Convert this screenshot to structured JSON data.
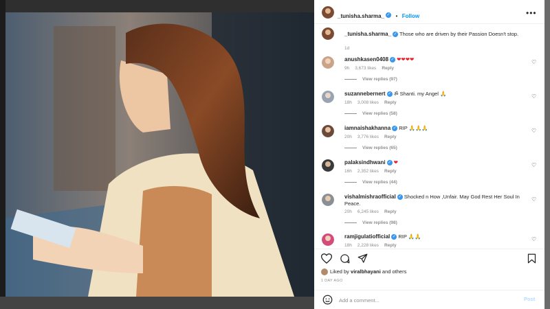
{
  "header": {
    "username": "_tunisha.sharma_",
    "follow_label": "Follow",
    "separator": "•",
    "more_icon": "more-horizontal-icon"
  },
  "caption": {
    "username": "_tunisha.sharma_",
    "text": "Those who are driven by their Passion Doesn't stop.",
    "age": "1d"
  },
  "comments": [
    {
      "username": "anushkasen0408",
      "text": "❤❤❤❤",
      "age": "9h",
      "likes": "3,673 likes",
      "reply": "Reply",
      "view_replies": "View replies (97)"
    },
    {
      "username": "suzannebernert",
      "text": "ॐ Shanti. my Angel 🙏",
      "age": "18h",
      "likes": "3,008 likes",
      "reply": "Reply",
      "view_replies": "View replies (58)"
    },
    {
      "username": "iamnaishakhanna",
      "text": "RIP 🙏🙏🙏",
      "age": "20h",
      "likes": "3,776 likes",
      "reply": "Reply",
      "view_replies": "View replies (65)"
    },
    {
      "username": "palaksindhwani",
      "text": "❤",
      "age": "16h",
      "likes": "2,352 likes",
      "reply": "Reply",
      "view_replies": "View replies (44)"
    },
    {
      "username": "vishalmishraofficial",
      "text": "Shocked n How ,Unfair. May God Rest Her Soul In Peace.",
      "age": "20h",
      "likes": "6,245 likes",
      "reply": "Reply",
      "view_replies": "View replies (98)"
    },
    {
      "username": "ramjigulatiofficial",
      "text": "RIP 🙏🙏",
      "age": "18h",
      "likes": "2,228 likes",
      "reply": "Reply",
      "view_replies": ""
    }
  ],
  "actions": {
    "liked_by_prefix": "Liked by",
    "liked_by_user": "viralbhayani",
    "liked_by_suffix": "and others",
    "time_ago": "1 DAY AGO"
  },
  "add_comment": {
    "placeholder": "Add a comment...",
    "post_label": "Post"
  },
  "colors": {
    "accent": "#0095f6",
    "verified": "#3897f0",
    "heart_red": "#ed1c24",
    "muted": "#8e8e8e"
  }
}
